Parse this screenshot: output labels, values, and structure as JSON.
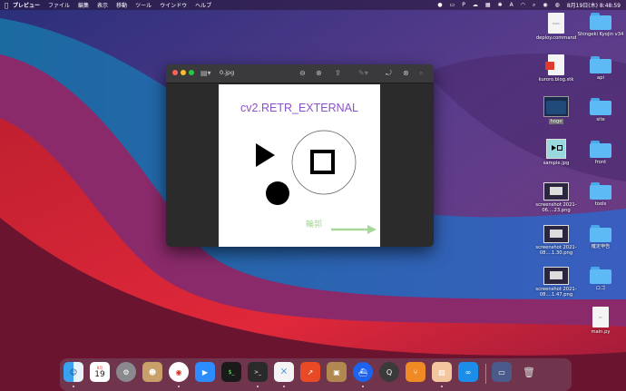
{
  "menubar": {
    "app": "プレビュー",
    "items": [
      "ファイル",
      "編集",
      "表示",
      "移動",
      "ツール",
      "ウインドウ",
      "ヘルプ"
    ],
    "status_icons": [
      "P",
      "A"
    ],
    "clock": "8月19日(木) 8:48:59"
  },
  "window": {
    "title": "0.jpg",
    "toolbar_icons": [
      "sidebar-icon",
      "zoom-out-icon",
      "zoom-in-icon",
      "share-icon",
      "markup-icon",
      "rotate-icon",
      "annotate-icon",
      "search-icon"
    ]
  },
  "document": {
    "heading": "cv2.RETR_EXTERNAL",
    "label": "輪郭"
  },
  "desktop_icons": [
    {
      "name": "deploy.command",
      "kind": "file"
    },
    {
      "name": "Shingeki Kyojin v34",
      "kind": "folder"
    },
    {
      "name": "kuroro.blog.stk",
      "kind": "file-red"
    },
    {
      "name": "api",
      "kind": "folder"
    },
    {
      "name": "hoge",
      "kind": "folder-dark"
    },
    {
      "name": "site",
      "kind": "folder"
    },
    {
      "name": "sample.jpg",
      "kind": "image"
    },
    {
      "name": "front",
      "kind": "folder"
    },
    {
      "name": "screenshot 2021-06....23.png",
      "kind": "shot"
    },
    {
      "name": "tools",
      "kind": "folder"
    },
    {
      "name": "screenshot 2021-08....1.30.png",
      "kind": "shot"
    },
    {
      "name": "確定申告",
      "kind": "folder"
    },
    {
      "name": "screenshot 2021-08....1.47.png",
      "kind": "shot"
    },
    {
      "name": "ロゴ",
      "kind": "folder"
    },
    {
      "name": "main.py",
      "kind": "file"
    }
  ],
  "dock": {
    "calendar_month": "8月",
    "calendar_day": "19",
    "apps": [
      "finder-icon",
      "calendar-icon",
      "system-preferences-icon",
      "contacts-icon",
      "chrome-icon",
      "zoom-icon",
      "terminal-icon",
      "terminal-alt-icon",
      "vscode-icon",
      "instruments-icon",
      "archive-utility-icon",
      "docker-icon",
      "quicktime-icon",
      "sourcetree-icon",
      "preview-icon",
      "infinity-icon",
      "screenshot-icon",
      "trash-icon"
    ]
  }
}
